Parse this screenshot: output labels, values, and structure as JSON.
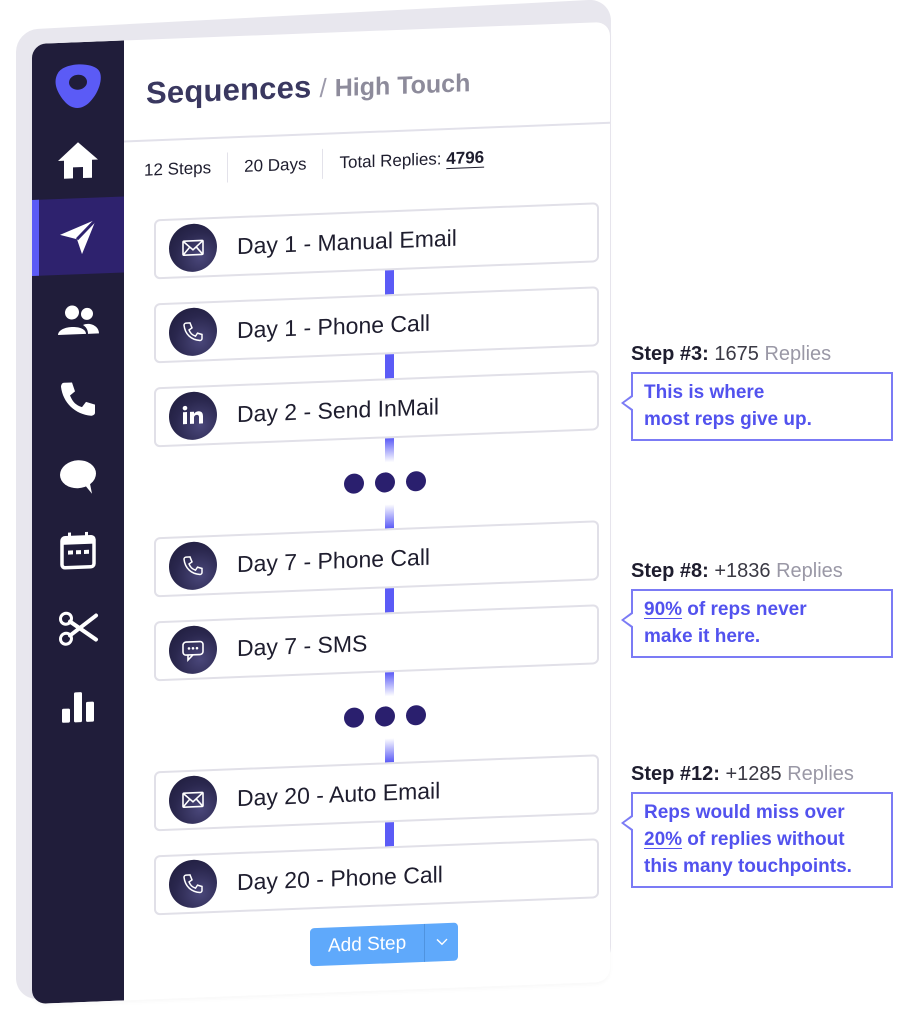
{
  "sidebar": {
    "logo": "outreach-logo",
    "items": [
      {
        "icon": "home-icon",
        "active": false
      },
      {
        "icon": "paper-plane-icon",
        "active": true
      },
      {
        "icon": "people-icon",
        "active": false
      },
      {
        "icon": "phone-icon",
        "active": false
      },
      {
        "icon": "chat-bubble-icon",
        "active": false
      },
      {
        "icon": "calendar-icon",
        "active": false
      },
      {
        "icon": "scissors-icon",
        "active": false
      },
      {
        "icon": "bar-chart-icon",
        "active": false
      }
    ]
  },
  "header": {
    "title": "Sequences",
    "separator": "/",
    "subtitle": "High Touch"
  },
  "stats": {
    "steps": "12 Steps",
    "days": "20 Days",
    "total_replies_label": "Total Replies:",
    "total_replies_value": "4796"
  },
  "steps": [
    {
      "icon": "email-icon",
      "label": "Day 1 - Manual Email"
    },
    {
      "icon": "phone-icon",
      "label": "Day 1 - Phone Call"
    },
    {
      "icon": "linkedin-icon",
      "label": "Day 2 - Send InMail"
    },
    {
      "icon": "phone-icon",
      "label": "Day 7 - Phone Call"
    },
    {
      "icon": "sms-icon",
      "label": "Day 7 - SMS"
    },
    {
      "icon": "email-icon",
      "label": "Day 20 - Auto Email"
    },
    {
      "icon": "phone-icon",
      "label": "Day 20 - Phone Call"
    }
  ],
  "add_step": {
    "label": "Add Step",
    "dropdown_icon": "chevron-down-icon"
  },
  "annotations": [
    {
      "step": "Step #3:",
      "value": "1675",
      "unit": "Replies",
      "lines": [
        "This is where",
        "most reps give up."
      ]
    },
    {
      "step": "Step #8:",
      "value": "+1836",
      "unit": "Replies",
      "highlight": "90%",
      "line1_rest": " of reps never",
      "line2": "make it here."
    },
    {
      "step": "Step #12:",
      "value": "+1285",
      "unit": "Replies",
      "line1": "Reps would miss over",
      "highlight": "20%",
      "line2_rest": " of replies without",
      "line3": "this many touchpoints."
    }
  ],
  "colors": {
    "sidebar_bg": "#201d3a",
    "active_bg": "#2e226e",
    "accent": "#5b5bf6",
    "logo": "#5b5bf6",
    "callout_text": "#5252ee",
    "add_step_button": "#5fa9fb"
  }
}
